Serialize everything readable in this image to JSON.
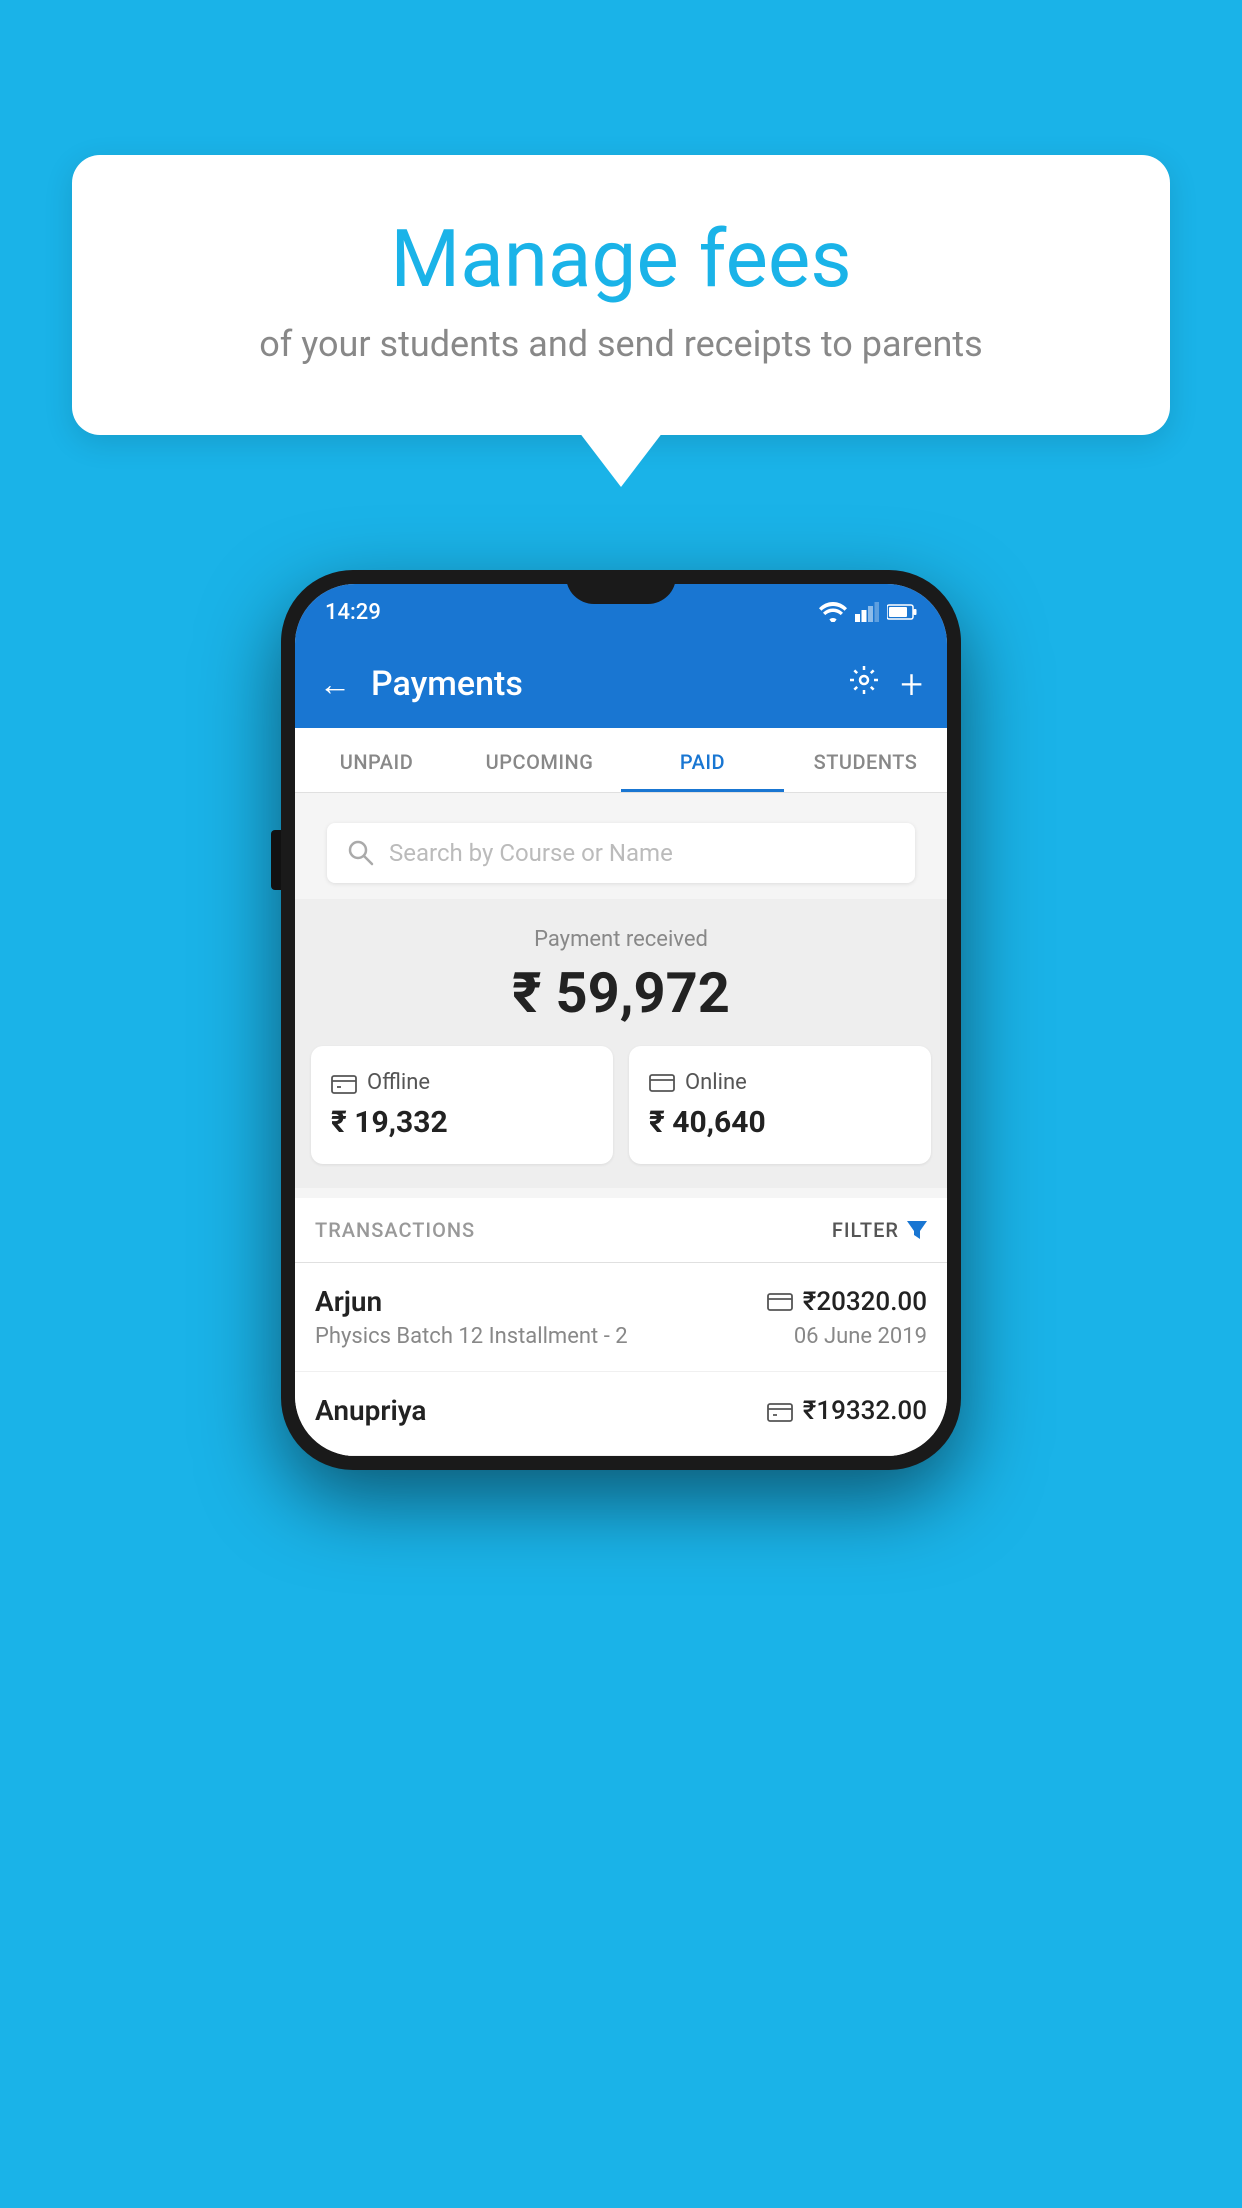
{
  "background_color": "#1ab3e8",
  "bubble": {
    "title": "Manage fees",
    "subtitle": "of your students and send receipts to parents"
  },
  "status_bar": {
    "time": "14:29",
    "icons": [
      "wifi",
      "signal",
      "battery"
    ]
  },
  "app_bar": {
    "title": "Payments",
    "back_label": "←",
    "settings_label": "⚙",
    "add_label": "+"
  },
  "tabs": [
    {
      "label": "UNPAID",
      "active": false
    },
    {
      "label": "UPCOMING",
      "active": false
    },
    {
      "label": "PAID",
      "active": true
    },
    {
      "label": "STUDENTS",
      "active": false
    }
  ],
  "search": {
    "placeholder": "Search by Course or Name"
  },
  "payment_received": {
    "label": "Payment received",
    "total": "₹ 59,972",
    "offline": {
      "icon": "💳",
      "label": "Offline",
      "amount": "₹ 19,332"
    },
    "online": {
      "icon": "💳",
      "label": "Online",
      "amount": "₹ 40,640"
    }
  },
  "transactions": {
    "header_label": "TRANSACTIONS",
    "filter_label": "FILTER",
    "rows": [
      {
        "name": "Arjun",
        "amount": "₹20320.00",
        "course": "Physics Batch 12 Installment - 2",
        "date": "06 June 2019",
        "payment_type": "online"
      },
      {
        "name": "Anupriya",
        "amount": "₹19332.00",
        "course": "",
        "date": "",
        "payment_type": "offline"
      }
    ]
  }
}
